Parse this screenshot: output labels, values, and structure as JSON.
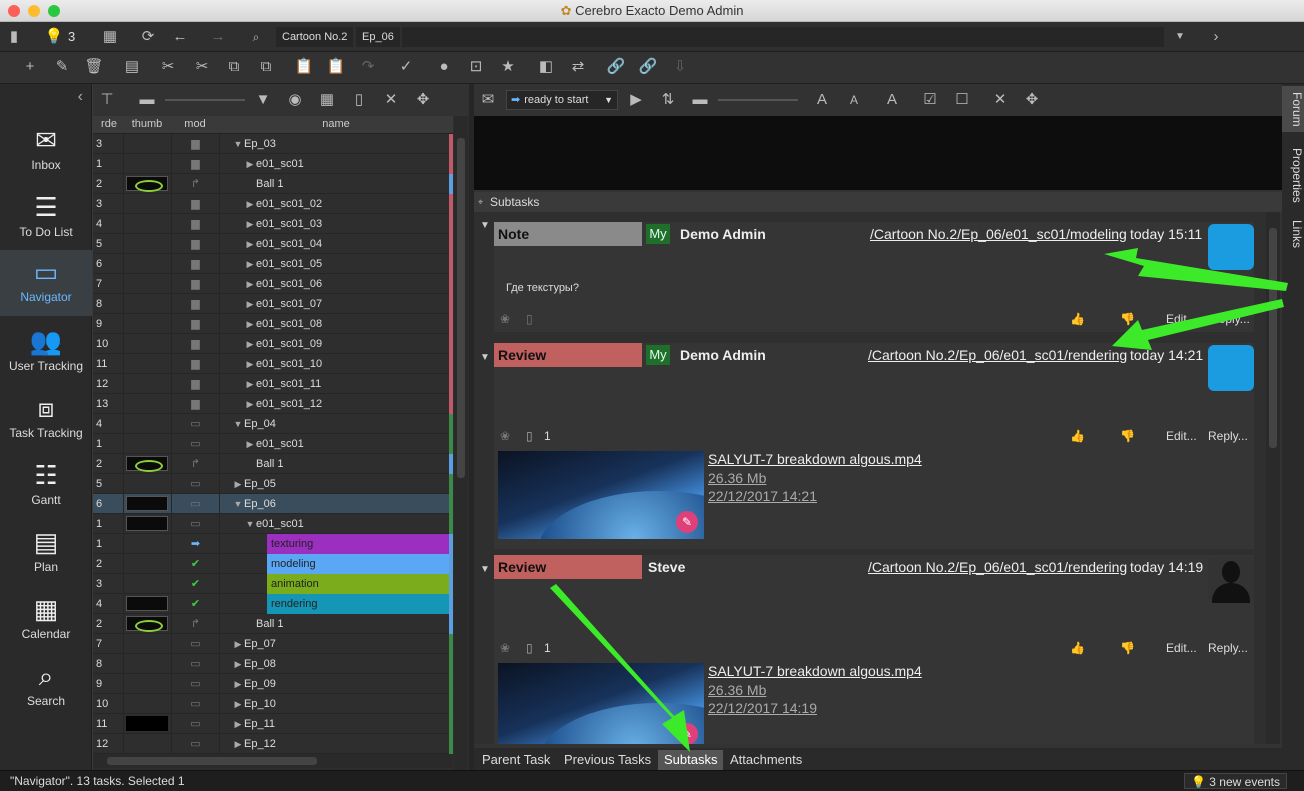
{
  "window": {
    "title": "Cerebro Exacto  Demo Admin"
  },
  "toolbar1": {
    "notifications_count": "3",
    "breadcrumbs": [
      "Cartoon No.2",
      "Ep_06"
    ]
  },
  "sidebar": {
    "items": [
      {
        "label": "Inbox",
        "icon": "inbox-icon"
      },
      {
        "label": "To Do List",
        "icon": "todo-list-icon"
      },
      {
        "label": "Navigator",
        "icon": "folder-icon"
      },
      {
        "label": "User Tracking",
        "icon": "users-icon"
      },
      {
        "label": "Task Tracking",
        "icon": "task-tracking-icon"
      },
      {
        "label": "Gantt",
        "icon": "gantt-icon"
      },
      {
        "label": "Plan",
        "icon": "plan-icon"
      },
      {
        "label": "Calendar",
        "icon": "calendar-icon"
      },
      {
        "label": "Search",
        "icon": "search-icon"
      }
    ]
  },
  "tree": {
    "headers": [
      "rde",
      "thumb",
      "mod",
      "name"
    ],
    "rows": [
      {
        "order": "3",
        "name": "Ep_03",
        "level": 0,
        "toggle": "open",
        "mod": "folder",
        "thumb": "",
        "stripe": "#c05a6a"
      },
      {
        "order": "1",
        "name": "e01_sc01",
        "level": 1,
        "toggle": "closed",
        "mod": "folder",
        "thumb": "",
        "stripe": "#c05a6a"
      },
      {
        "order": "2",
        "name": "Ball 1",
        "level": 1,
        "toggle": "",
        "mod": "link",
        "thumb": "green",
        "stripe": "#5aa0e0"
      },
      {
        "order": "3",
        "name": "e01_sc01_02",
        "level": 1,
        "toggle": "closed",
        "mod": "folder",
        "thumb": "",
        "stripe": "#c05a6a"
      },
      {
        "order": "4",
        "name": "e01_sc01_03",
        "level": 1,
        "toggle": "closed",
        "mod": "folder",
        "thumb": "",
        "stripe": "#c05a6a"
      },
      {
        "order": "5",
        "name": "e01_sc01_04",
        "level": 1,
        "toggle": "closed",
        "mod": "folder",
        "thumb": "",
        "stripe": "#c05a6a"
      },
      {
        "order": "6",
        "name": "e01_sc01_05",
        "level": 1,
        "toggle": "closed",
        "mod": "folder",
        "thumb": "",
        "stripe": "#c05a6a"
      },
      {
        "order": "7",
        "name": "e01_sc01_06",
        "level": 1,
        "toggle": "closed",
        "mod": "folder",
        "thumb": "",
        "stripe": "#c05a6a"
      },
      {
        "order": "8",
        "name": "e01_sc01_07",
        "level": 1,
        "toggle": "closed",
        "mod": "folder",
        "thumb": "",
        "stripe": "#c05a6a"
      },
      {
        "order": "9",
        "name": "e01_sc01_08",
        "level": 1,
        "toggle": "closed",
        "mod": "folder",
        "thumb": "",
        "stripe": "#c05a6a"
      },
      {
        "order": "10",
        "name": "e01_sc01_09",
        "level": 1,
        "toggle": "closed",
        "mod": "folder",
        "thumb": "",
        "stripe": "#c05a6a"
      },
      {
        "order": "11",
        "name": "e01_sc01_10",
        "level": 1,
        "toggle": "closed",
        "mod": "folder",
        "thumb": "",
        "stripe": "#c05a6a"
      },
      {
        "order": "12",
        "name": "e01_sc01_11",
        "level": 1,
        "toggle": "closed",
        "mod": "folder",
        "thumb": "",
        "stripe": "#c05a6a"
      },
      {
        "order": "13",
        "name": "e01_sc01_12",
        "level": 1,
        "toggle": "closed",
        "mod": "folder",
        "thumb": "",
        "stripe": "#c05a6a"
      },
      {
        "order": "4",
        "name": "Ep_04",
        "level": 0,
        "toggle": "open",
        "mod": "folder-outline",
        "thumb": "",
        "stripe": "#3c8a4a"
      },
      {
        "order": "1",
        "name": "e01_sc01",
        "level": 1,
        "toggle": "closed",
        "mod": "folder-outline",
        "thumb": "",
        "stripe": "#3c8a4a"
      },
      {
        "order": "2",
        "name": "Ball 1",
        "level": 1,
        "toggle": "",
        "mod": "link",
        "thumb": "green",
        "stripe": "#5aa0e0"
      },
      {
        "order": "5",
        "name": "Ep_05",
        "level": 0,
        "toggle": "closed",
        "mod": "folder-outline",
        "thumb": "",
        "stripe": "#3c8a4a"
      },
      {
        "order": "6",
        "name": "Ep_06",
        "level": 0,
        "toggle": "open",
        "mod": "folder-outline",
        "thumb": "dark",
        "stripe": "#3c8a4a",
        "selected": true
      },
      {
        "order": "1",
        "name": "e01_sc01",
        "level": 1,
        "toggle": "open",
        "mod": "folder-outline",
        "thumb": "dark",
        "stripe": "#3c8a4a"
      },
      {
        "order": "1",
        "name": "texturing",
        "level": 2,
        "toggle": "",
        "mod": "arrow",
        "thumb": "",
        "stripe": "#5aa0e0",
        "bar": "#9b2fc0"
      },
      {
        "order": "2",
        "name": "modeling",
        "level": 2,
        "toggle": "",
        "mod": "check",
        "thumb": "",
        "stripe": "#5aa0e0",
        "bar": "#5aa7f5"
      },
      {
        "order": "3",
        "name": "animation",
        "level": 2,
        "toggle": "",
        "mod": "check",
        "thumb": "",
        "stripe": "#5aa0e0",
        "bar": "#7aac1c"
      },
      {
        "order": "4",
        "name": "rendering",
        "level": 2,
        "toggle": "",
        "mod": "check",
        "thumb": "dark",
        "stripe": "#5aa0e0",
        "bar": "#1696b6"
      },
      {
        "order": "2",
        "name": "Ball 1",
        "level": 1,
        "toggle": "",
        "mod": "link",
        "thumb": "green",
        "stripe": "#5aa0e0"
      },
      {
        "order": "7",
        "name": "Ep_07",
        "level": 0,
        "toggle": "closed",
        "mod": "folder-outline",
        "thumb": "",
        "stripe": "#3c8a4a"
      },
      {
        "order": "8",
        "name": "Ep_08",
        "level": 0,
        "toggle": "closed",
        "mod": "folder-outline",
        "thumb": "",
        "stripe": "#3c8a4a"
      },
      {
        "order": "9",
        "name": "Ep_09",
        "level": 0,
        "toggle": "closed",
        "mod": "folder-outline",
        "thumb": "",
        "stripe": "#3c8a4a"
      },
      {
        "order": "10",
        "name": "Ep_10",
        "level": 0,
        "toggle": "closed",
        "mod": "folder-outline",
        "thumb": "",
        "stripe": "#3c8a4a"
      },
      {
        "order": "11",
        "name": "Ep_11",
        "level": 0,
        "toggle": "closed",
        "mod": "folder-outline",
        "thumb": "black",
        "stripe": "#3c8a4a"
      },
      {
        "order": "12",
        "name": "Ep_12",
        "level": 0,
        "toggle": "closed",
        "mod": "folder-outline",
        "thumb": "",
        "stripe": "#3c8a4a"
      }
    ]
  },
  "right_toolbar": {
    "status": "ready to start"
  },
  "subtasks_header": "Subtasks",
  "messages": [
    {
      "type": "Note",
      "type_color": "#8a8a8a",
      "my": "My",
      "author": "Demo Admin",
      "path": "/Cartoon No.2/Ep_06/e01_sc01/modeling",
      "time": "today 15:11",
      "text": "Где текстуры?",
      "attachments": "",
      "edit": "Edit...",
      "reply": "Reply...",
      "avatar": "logo"
    },
    {
      "type": "Review",
      "type_color": "#c0605f",
      "my": "My",
      "author": "Demo Admin",
      "path": "/Cartoon No.2/Ep_06/e01_sc01/rendering",
      "time": "today 14:21",
      "text": "",
      "attachments": "1",
      "edit": "Edit...",
      "reply": "Reply...",
      "avatar": "logo",
      "file": {
        "name": "SALYUT-7 breakdown algous.mp4",
        "size": "26.36 Mb",
        "date": "22/12/2017 14:21"
      }
    },
    {
      "type": "Review",
      "type_color": "#c0605f",
      "my": "",
      "author": "Steve",
      "path": "/Cartoon No.2/Ep_06/e01_sc01/rendering",
      "time": "today 14:19",
      "text": "",
      "attachments": "1",
      "edit": "Edit...",
      "reply": "Reply...",
      "avatar": "person",
      "file": {
        "name": "SALYUT-7 breakdown algous.mp4",
        "size": "26.36 Mb",
        "date": "22/12/2017 14:19"
      }
    }
  ],
  "bottom_tabs": [
    "Parent Task",
    "Previous Tasks",
    "Subtasks",
    "Attachments"
  ],
  "vertical_tabs": [
    "Forum",
    "Properties",
    "Links"
  ],
  "status": {
    "left": "\"Navigator\". 13 tasks. Selected 1",
    "right": "3 new events"
  },
  "colors": {
    "accent": "#6ab8ff",
    "arrow": "#3dea2a"
  }
}
